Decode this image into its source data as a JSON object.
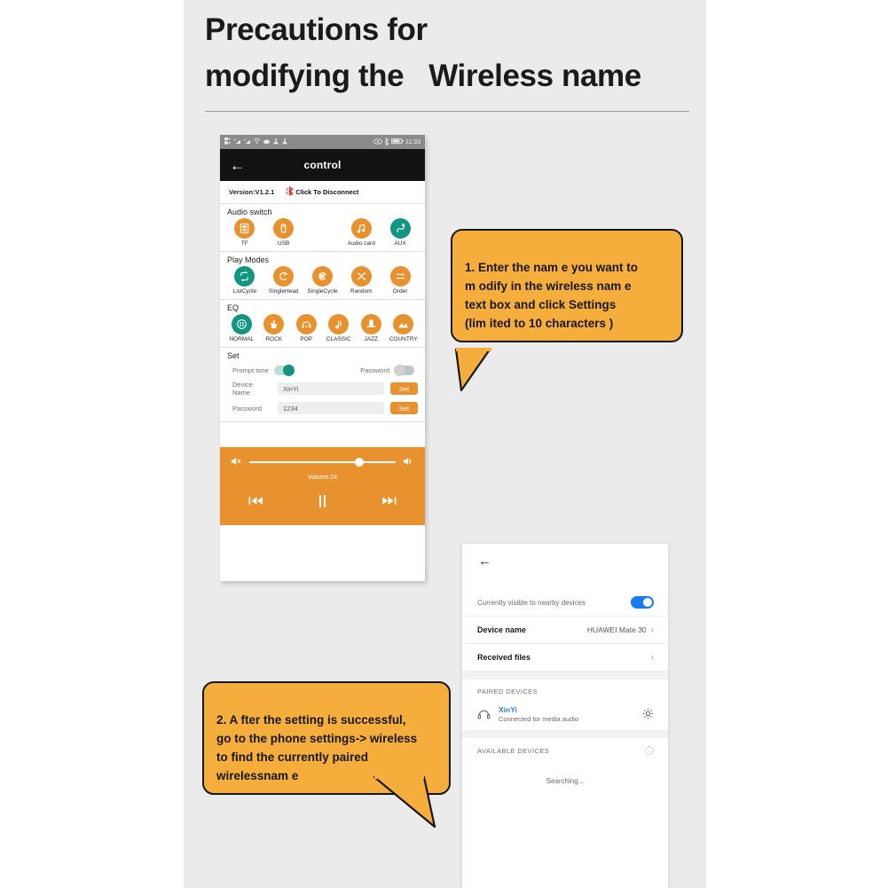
{
  "heading": {
    "line1": "Precautions for",
    "line2": "modifying the   Wireless name"
  },
  "colors": {
    "page_bg": "#ebebeb",
    "callout_orange": "#f5ae3c",
    "player_orange": "#e8922f",
    "active_teal": "#139680",
    "bt_blue": "#1a7bf0",
    "link_blue": "#2f7de1",
    "disconnect_red": "#e01a22"
  },
  "phone_app": {
    "status_bar": {
      "time": "11:33",
      "left_icons": [
        "sim-card-icon",
        "signal-bars-icon",
        "signal-bars-icon",
        "wifi-icon",
        "cloud-icon",
        "sync-icon",
        "sync-icon"
      ],
      "right_icons": [
        "eye-icon",
        "bluetooth-icon",
        "battery-icon"
      ]
    },
    "title_bar": {
      "back_icon": "back-arrow-icon",
      "title": "control"
    },
    "version_row": {
      "version": "Version:V1.2.1",
      "disconnect_icon": "bluetooth-icon",
      "disconnect_label": "Click To Disconnect"
    },
    "audio_switch": {
      "title": "Audio switch",
      "items": [
        {
          "label": "TF",
          "icon": "tf-card-icon",
          "active": false
        },
        {
          "label": "USB",
          "icon": "usb-stick-icon",
          "active": false
        },
        {
          "label": "",
          "icon": "",
          "active": false
        },
        {
          "label": "Audio card",
          "icon": "music-note-icon",
          "active": false
        },
        {
          "label": "AUX",
          "icon": "aux-cable-icon",
          "active": true
        }
      ]
    },
    "play_modes": {
      "title": "Play Modes",
      "items": [
        {
          "label": "ListCycle",
          "icon": "list-cycle-icon",
          "active": true
        },
        {
          "label": "SingleHead",
          "icon": "single-head-icon",
          "active": false
        },
        {
          "label": "SingleCycle",
          "icon": "single-cycle-icon",
          "active": false
        },
        {
          "label": "Random",
          "icon": "shuffle-icon",
          "active": false
        },
        {
          "label": "Order",
          "icon": "order-icon",
          "active": false
        }
      ]
    },
    "eq": {
      "title": "EQ",
      "items": [
        {
          "label": "NORMAL",
          "icon": "normal-eq-icon",
          "active": true
        },
        {
          "label": "ROCK",
          "icon": "rock-hand-icon",
          "active": false
        },
        {
          "label": "POP",
          "icon": "headphone-icon",
          "active": false
        },
        {
          "label": "CLASSIC",
          "icon": "classic-note-icon",
          "active": false
        },
        {
          "label": "JAZZ",
          "icon": "top-hat-icon",
          "active": false
        },
        {
          "label": "COUNTRY",
          "icon": "country-icon",
          "active": false
        }
      ]
    },
    "set": {
      "title": "Set",
      "prompt_tone_label": "Prompt tone",
      "prompt_tone_on": true,
      "password_toggle_label": "Password",
      "password_toggle_on": false,
      "device_name_label": "Device Name",
      "device_name_value": "XinYi",
      "device_name_button": "Set",
      "password_label": "Password",
      "password_value": "1234",
      "password_button": "Set"
    },
    "player": {
      "mute_icon": "volume-mute-icon",
      "volume_up_icon": "volume-up-icon",
      "volume_text": "Volume:24",
      "volume_percent": 72,
      "prev_icon": "previous-track-icon",
      "pause_icon": "pause-icon",
      "next_icon": "next-track-icon"
    }
  },
  "bluetooth_settings": {
    "back_icon": "back-arrow-icon",
    "visible_label": "Currently visible to nearby devices",
    "visible_on": true,
    "device_name_key": "Device name",
    "device_name_value": "HUAWEI Mate 30",
    "received_files_key": "Received files",
    "paired_caption": "PAIRED DEVICES",
    "paired_device": {
      "icon": "headphone-icon",
      "name": "XinYi",
      "status": "Connected for media audio",
      "settings_icon": "gear-icon"
    },
    "available_caption": "AVAILABLE DEVICES",
    "available_spinner_icon": "loading-spinner-icon",
    "searching_text": "Searching..."
  },
  "callouts": [
    {
      "text": "1. Enter the nam e you want to\nm odify in the wireless nam e\ntext box and click Settings\n(lim ited to 10 characters )"
    },
    {
      "text": "2. A fter the setting is successful,\n go to the phone settings-> wireless\nto find the currently paired\nwirelessnam e"
    }
  ]
}
